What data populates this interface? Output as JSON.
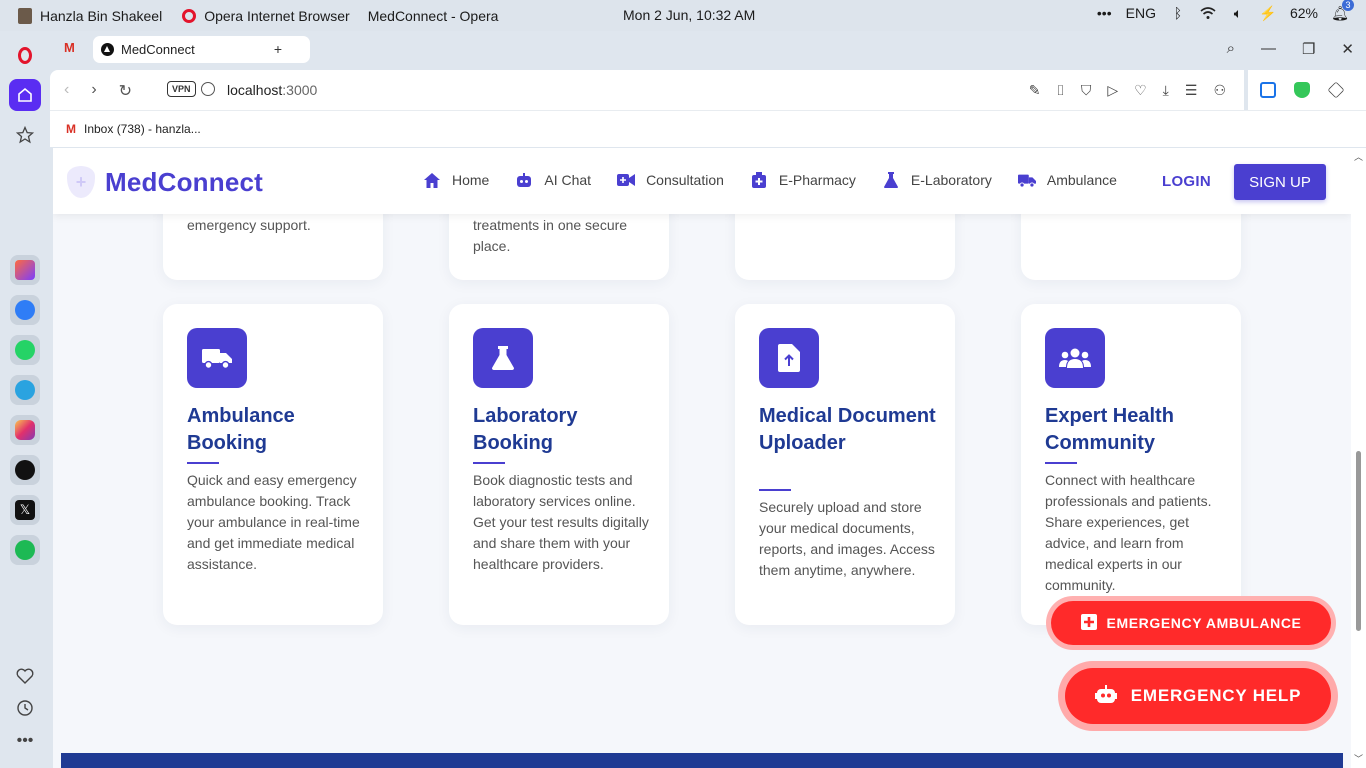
{
  "os": {
    "user": "Hanzla Bin Shakeel",
    "app": "Opera Internet Browser",
    "window_title": "MedConnect - Opera",
    "clock": "Mon 2 Jun, 10:32 AM",
    "lang": "ENG",
    "battery": "62%",
    "notifications": "3"
  },
  "browser": {
    "tab_title": "MedConnect",
    "url_host": "localhost",
    "url_port": ":3000",
    "vpn_label": "VPN",
    "bookmark": "Inbox (738) - hanzla..."
  },
  "site": {
    "brand": "MedConnect",
    "nav": [
      {
        "label": "Home",
        "icon": "home-icon"
      },
      {
        "label": "AI Chat",
        "icon": "robot-icon"
      },
      {
        "label": "Consultation",
        "icon": "video-icon"
      },
      {
        "label": "E-Pharmacy",
        "icon": "medkit-icon"
      },
      {
        "label": "E-Laboratory",
        "icon": "flask-icon"
      },
      {
        "label": "Ambulance",
        "icon": "truck-icon"
      }
    ],
    "login": "LOGIN",
    "signup": "SIGN UP"
  },
  "top_cards": [
    {
      "text_line1": "emergency support.",
      "text_line2": ""
    },
    {
      "text_line1": "treatments in one secure",
      "text_line2": "place."
    },
    {
      "text_line1": "",
      "text_line2": ""
    },
    {
      "text_line1": "",
      "text_line2": ""
    }
  ],
  "cards": [
    {
      "title": "Ambulance Booking",
      "icon": "ambulance-truck-icon",
      "desc": "Quick and easy emergency ambulance booking. Track your ambulance in real-time and get immediate medical assistance."
    },
    {
      "title": "Laboratory Booking",
      "icon": "flask-icon",
      "desc": "Book diagnostic tests and laboratory services online. Get your test results digitally and share them with your healthcare providers."
    },
    {
      "title": "Medical Document Uploader",
      "icon": "file-upload-icon",
      "desc": "Securely upload and store your medical documents, reports, and images. Access them anytime, anywhere."
    },
    {
      "title": "Expert Health Community",
      "icon": "users-icon",
      "desc": "Connect with healthcare professionals and patients. Share experiences, get advice, and learn from medical experts in our community."
    }
  ],
  "emergency": {
    "ambulance": "EMERGENCY AMBULANCE",
    "help": "EMERGENCY HELP"
  }
}
